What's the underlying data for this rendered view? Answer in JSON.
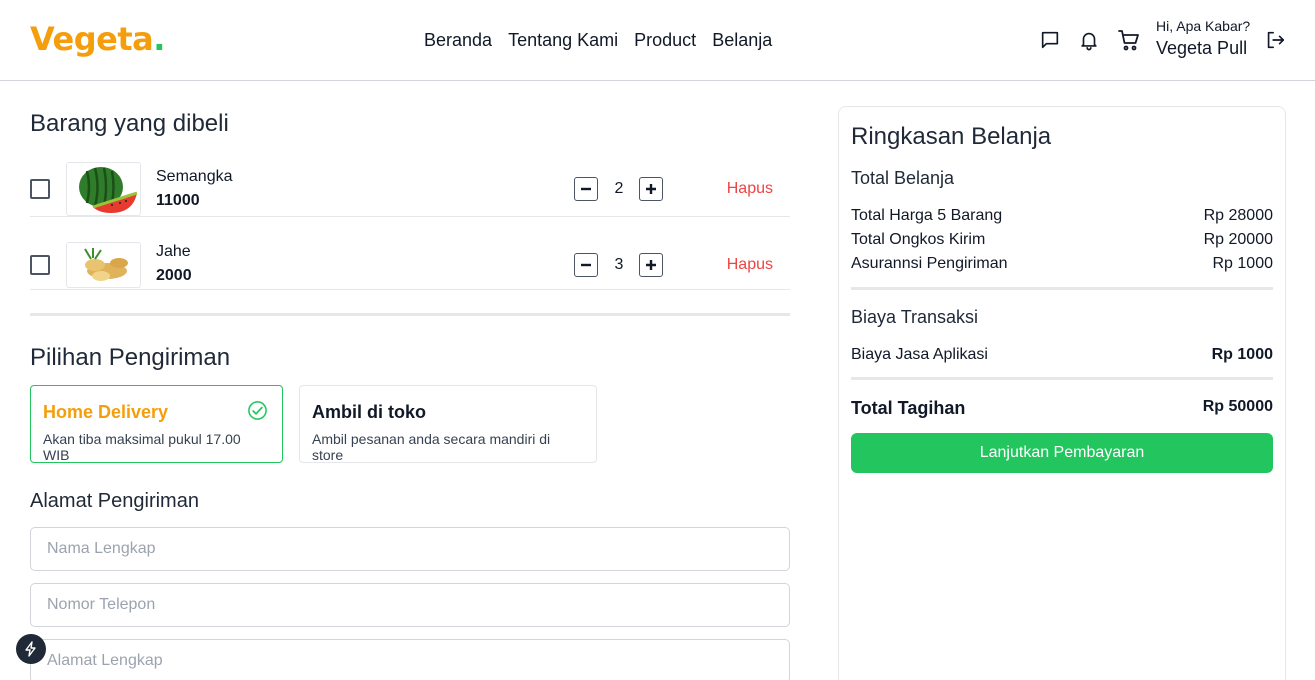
{
  "brand": {
    "logo_text": "Vegeta.",
    "primary_color": "#f59e0b",
    "accent_color": "#22c55e",
    "danger_color": "#ef4444"
  },
  "nav": {
    "items": [
      "Beranda",
      "Tentang Kami",
      "Product",
      "Belanja"
    ]
  },
  "header": {
    "icons": [
      "chat-icon",
      "bell-icon",
      "cart-icon",
      "logout-icon"
    ],
    "greeting": "Hi, Apa Kabar?",
    "username": "Vegeta Pull"
  },
  "cart": {
    "title": "Barang yang dibeli",
    "items": [
      {
        "name": "Semangka",
        "price": "11000",
        "qty": "2",
        "remove_label": "Hapus",
        "image": "watermelon"
      },
      {
        "name": "Jahe",
        "price": "2000",
        "qty": "3",
        "remove_label": "Hapus",
        "image": "ginger"
      }
    ]
  },
  "shipping": {
    "title": "Pilihan Pengiriman",
    "options": [
      {
        "title": "Home Delivery",
        "desc": "Akan tiba maksimal pukul 17.00 WIB",
        "selected": true
      },
      {
        "title": "Ambil di toko",
        "desc": "Ambil pesanan anda secara mandiri di store",
        "selected": false
      }
    ]
  },
  "address": {
    "title": "Alamat Pengiriman",
    "fields": [
      {
        "placeholder": "Nama Lengkap",
        "value": ""
      },
      {
        "placeholder": "Nomor Telepon",
        "value": ""
      },
      {
        "placeholder": "Alamat Lengkap",
        "value": ""
      }
    ]
  },
  "summary": {
    "title": "Ringkasan Belanja",
    "total_belanja_label": "Total Belanja",
    "rows": [
      {
        "label": "Total Harga 5 Barang",
        "value": "Rp 28000"
      },
      {
        "label": "Total Ongkos Kirim",
        "value": "Rp 20000"
      },
      {
        "label": "Asurannsi Pengiriman",
        "value": "Rp 1000"
      }
    ],
    "transaction_label": "Biaya Transaksi",
    "app_fee": {
      "label": "Biaya Jasa Aplikasi",
      "value": "Rp 1000"
    },
    "total": {
      "label": "Total Tagihan",
      "value": "Rp 50000"
    },
    "pay_button": "Lanjutkan Pembayaran"
  }
}
